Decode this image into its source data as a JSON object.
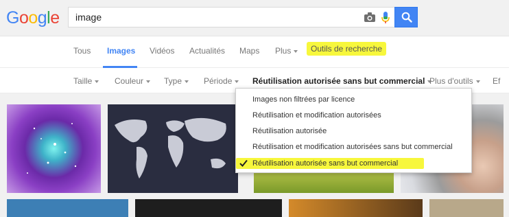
{
  "logo": {
    "text": "Google",
    "letters": [
      "G",
      "o",
      "o",
      "g",
      "l",
      "e"
    ],
    "colors": [
      "#4285f4",
      "#ea4335",
      "#fbbc05",
      "#4285f4",
      "#34a853",
      "#ea4335"
    ]
  },
  "search": {
    "value": "image",
    "icons": [
      "camera-icon",
      "microphone-icon",
      "search-icon"
    ]
  },
  "tabs": [
    {
      "label": "Tous"
    },
    {
      "label": "Images",
      "active": true
    },
    {
      "label": "Vidéos"
    },
    {
      "label": "Actualités"
    },
    {
      "label": "Maps"
    },
    {
      "label": "Plus"
    },
    {
      "label": "Outils de recherche",
      "highlighted": true
    }
  ],
  "tools": [
    {
      "label": "Taille"
    },
    {
      "label": "Couleur"
    },
    {
      "label": "Type"
    },
    {
      "label": "Période"
    },
    {
      "label": "Réutilisation autorisée sans but commercial",
      "active": true
    },
    {
      "label": "Plus d'outils"
    },
    {
      "label": "Ef"
    }
  ],
  "dropdown": {
    "options": [
      {
        "label": "Images non filtrées par licence"
      },
      {
        "label": "Réutilisation et modification autorisées"
      },
      {
        "label": "Réutilisation autorisée"
      },
      {
        "label": "Réutilisation et modification autorisées sans but commercial"
      },
      {
        "label": "Réutilisation autorisée sans but commercial",
        "selected": true
      }
    ]
  },
  "colors": {
    "accent": "#4285f4",
    "highlight": "#f7f73c"
  }
}
